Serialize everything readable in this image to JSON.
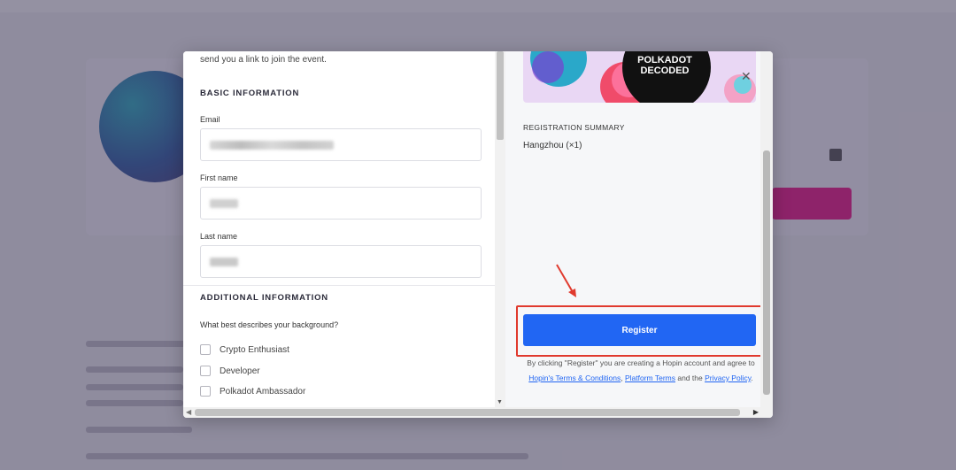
{
  "modal": {
    "intro_text": "send you a link to join the event.",
    "basic_section_title": "BASIC INFORMATION",
    "email_label": "Email",
    "first_name_label": "First name",
    "last_name_label": "Last name",
    "additional_section_title": "ADDITIONAL INFORMATION",
    "background_question": "What best describes your background?",
    "options": [
      "Crypto Enthusiast",
      "Developer",
      "Polkadot Ambassador"
    ],
    "close_icon": "close-icon",
    "banner_text": "POLKADOT DECODED",
    "summary_title": "REGISTRATION SUMMARY",
    "summary_item": "Hangzhou (×1)",
    "register_label": "Register",
    "terms_prefix": "By clicking \"Register\" you are creating a Hopin account and agree to ",
    "terms_link": "Hopin's Terms & Conditions",
    "terms_sep": ", ",
    "policy_link": "Platform Terms",
    "terms_and": " and the ",
    "privacy_link": "Privacy Policy",
    "terms_end": "."
  },
  "colors": {
    "accent": "#2166f3",
    "highlight": "#e03a2e",
    "brand_pink": "#e6007a"
  }
}
